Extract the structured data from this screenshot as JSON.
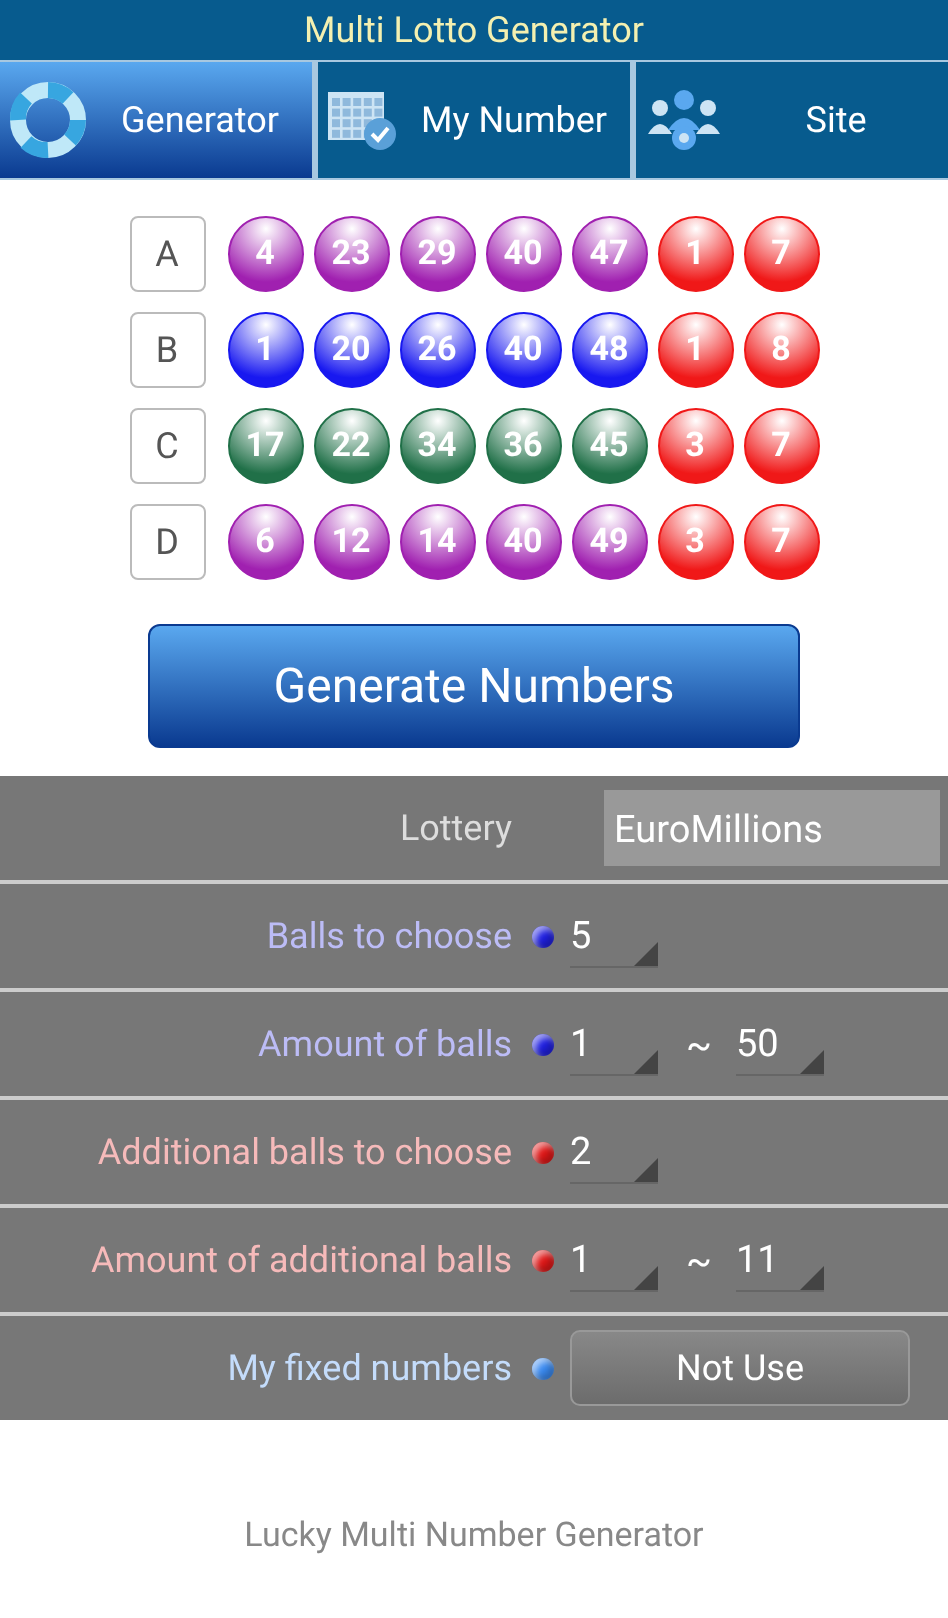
{
  "window": {
    "title": "Multi Lotto Generator"
  },
  "tabs": [
    {
      "label": "Generator",
      "selected": true
    },
    {
      "label": "My Number",
      "selected": false
    },
    {
      "label": "Site",
      "selected": false
    }
  ],
  "draws": [
    {
      "label": "A",
      "balls": [
        {
          "number": "4",
          "color": "#a020b0"
        },
        {
          "number": "23",
          "color": "#a020b0"
        },
        {
          "number": "29",
          "color": "#a020b0"
        },
        {
          "number": "40",
          "color": "#a020b0"
        },
        {
          "number": "47",
          "color": "#a020b0"
        },
        {
          "number": "1",
          "color": "#f01818"
        },
        {
          "number": "7",
          "color": "#f01818"
        }
      ]
    },
    {
      "label": "B",
      "balls": [
        {
          "number": "1",
          "color": "#1818f0"
        },
        {
          "number": "20",
          "color": "#1818f0"
        },
        {
          "number": "26",
          "color": "#1818f0"
        },
        {
          "number": "40",
          "color": "#1818f0"
        },
        {
          "number": "48",
          "color": "#1818f0"
        },
        {
          "number": "1",
          "color": "#f01818"
        },
        {
          "number": "8",
          "color": "#f01818"
        }
      ]
    },
    {
      "label": "C",
      "balls": [
        {
          "number": "17",
          "color": "#207048"
        },
        {
          "number": "22",
          "color": "#207048"
        },
        {
          "number": "34",
          "color": "#207048"
        },
        {
          "number": "36",
          "color": "#207048"
        },
        {
          "number": "45",
          "color": "#207048"
        },
        {
          "number": "3",
          "color": "#f01818"
        },
        {
          "number": "7",
          "color": "#f01818"
        }
      ]
    },
    {
      "label": "D",
      "balls": [
        {
          "number": "6",
          "color": "#a020b0"
        },
        {
          "number": "12",
          "color": "#a020b0"
        },
        {
          "number": "14",
          "color": "#a020b0"
        },
        {
          "number": "40",
          "color": "#a020b0"
        },
        {
          "number": "49",
          "color": "#a020b0"
        },
        {
          "number": "3",
          "color": "#f01818"
        },
        {
          "number": "7",
          "color": "#f01818"
        }
      ]
    }
  ],
  "generate_button": "Generate Numbers",
  "settings": [
    {
      "kind": "dropdown",
      "label": "Lottery",
      "value": "EuroMillions"
    },
    {
      "kind": "spinner",
      "label": "Balls to choose",
      "color": "#2020e0",
      "value": "5"
    },
    {
      "kind": "range",
      "label": "Amount of balls",
      "color": "#2020e0",
      "from": "1",
      "separator": "~",
      "to": "50"
    },
    {
      "kind": "spinner",
      "label": "Additional balls to choose",
      "color": "#e01818",
      "value": "2"
    },
    {
      "kind": "range",
      "label": "Amount of additional balls",
      "color": "#e01818",
      "from": "1",
      "separator": "~",
      "to": "11"
    },
    {
      "kind": "button",
      "label": "My fixed numbers",
      "color": "#3a8af0",
      "value": "Not Use"
    }
  ],
  "footer": "Lucky Multi Number Generator"
}
